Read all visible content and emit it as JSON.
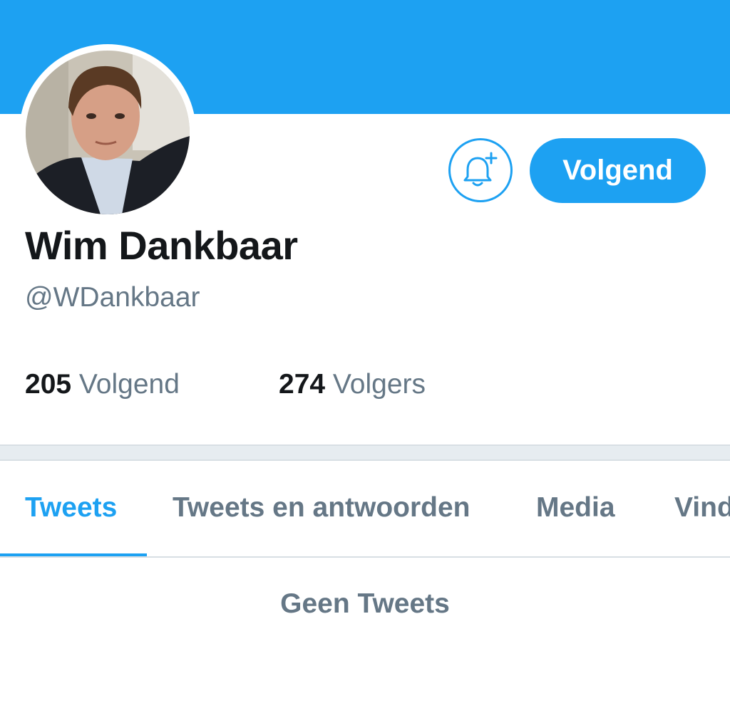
{
  "colors": {
    "accent": "#1da1f2",
    "text_primary": "#14171a",
    "text_secondary": "#657786",
    "separator": "#e6ecf0"
  },
  "profile": {
    "display_name": "Wim Dankbaar",
    "handle": "@WDankbaar",
    "avatar_icon": "profile-photo",
    "notify_icon": "bell-plus-icon",
    "follow_button_label": "Volgend"
  },
  "stats": {
    "following": {
      "count": "205",
      "label": "Volgend"
    },
    "followers": {
      "count": "274",
      "label": "Volgers"
    }
  },
  "tabs": [
    {
      "label": "Tweets",
      "active": true
    },
    {
      "label": "Tweets en antwoorden",
      "active": false
    },
    {
      "label": "Media",
      "active": false
    },
    {
      "label": "Vind",
      "active": false
    }
  ],
  "feed": {
    "empty_message": "Geen Tweets"
  }
}
